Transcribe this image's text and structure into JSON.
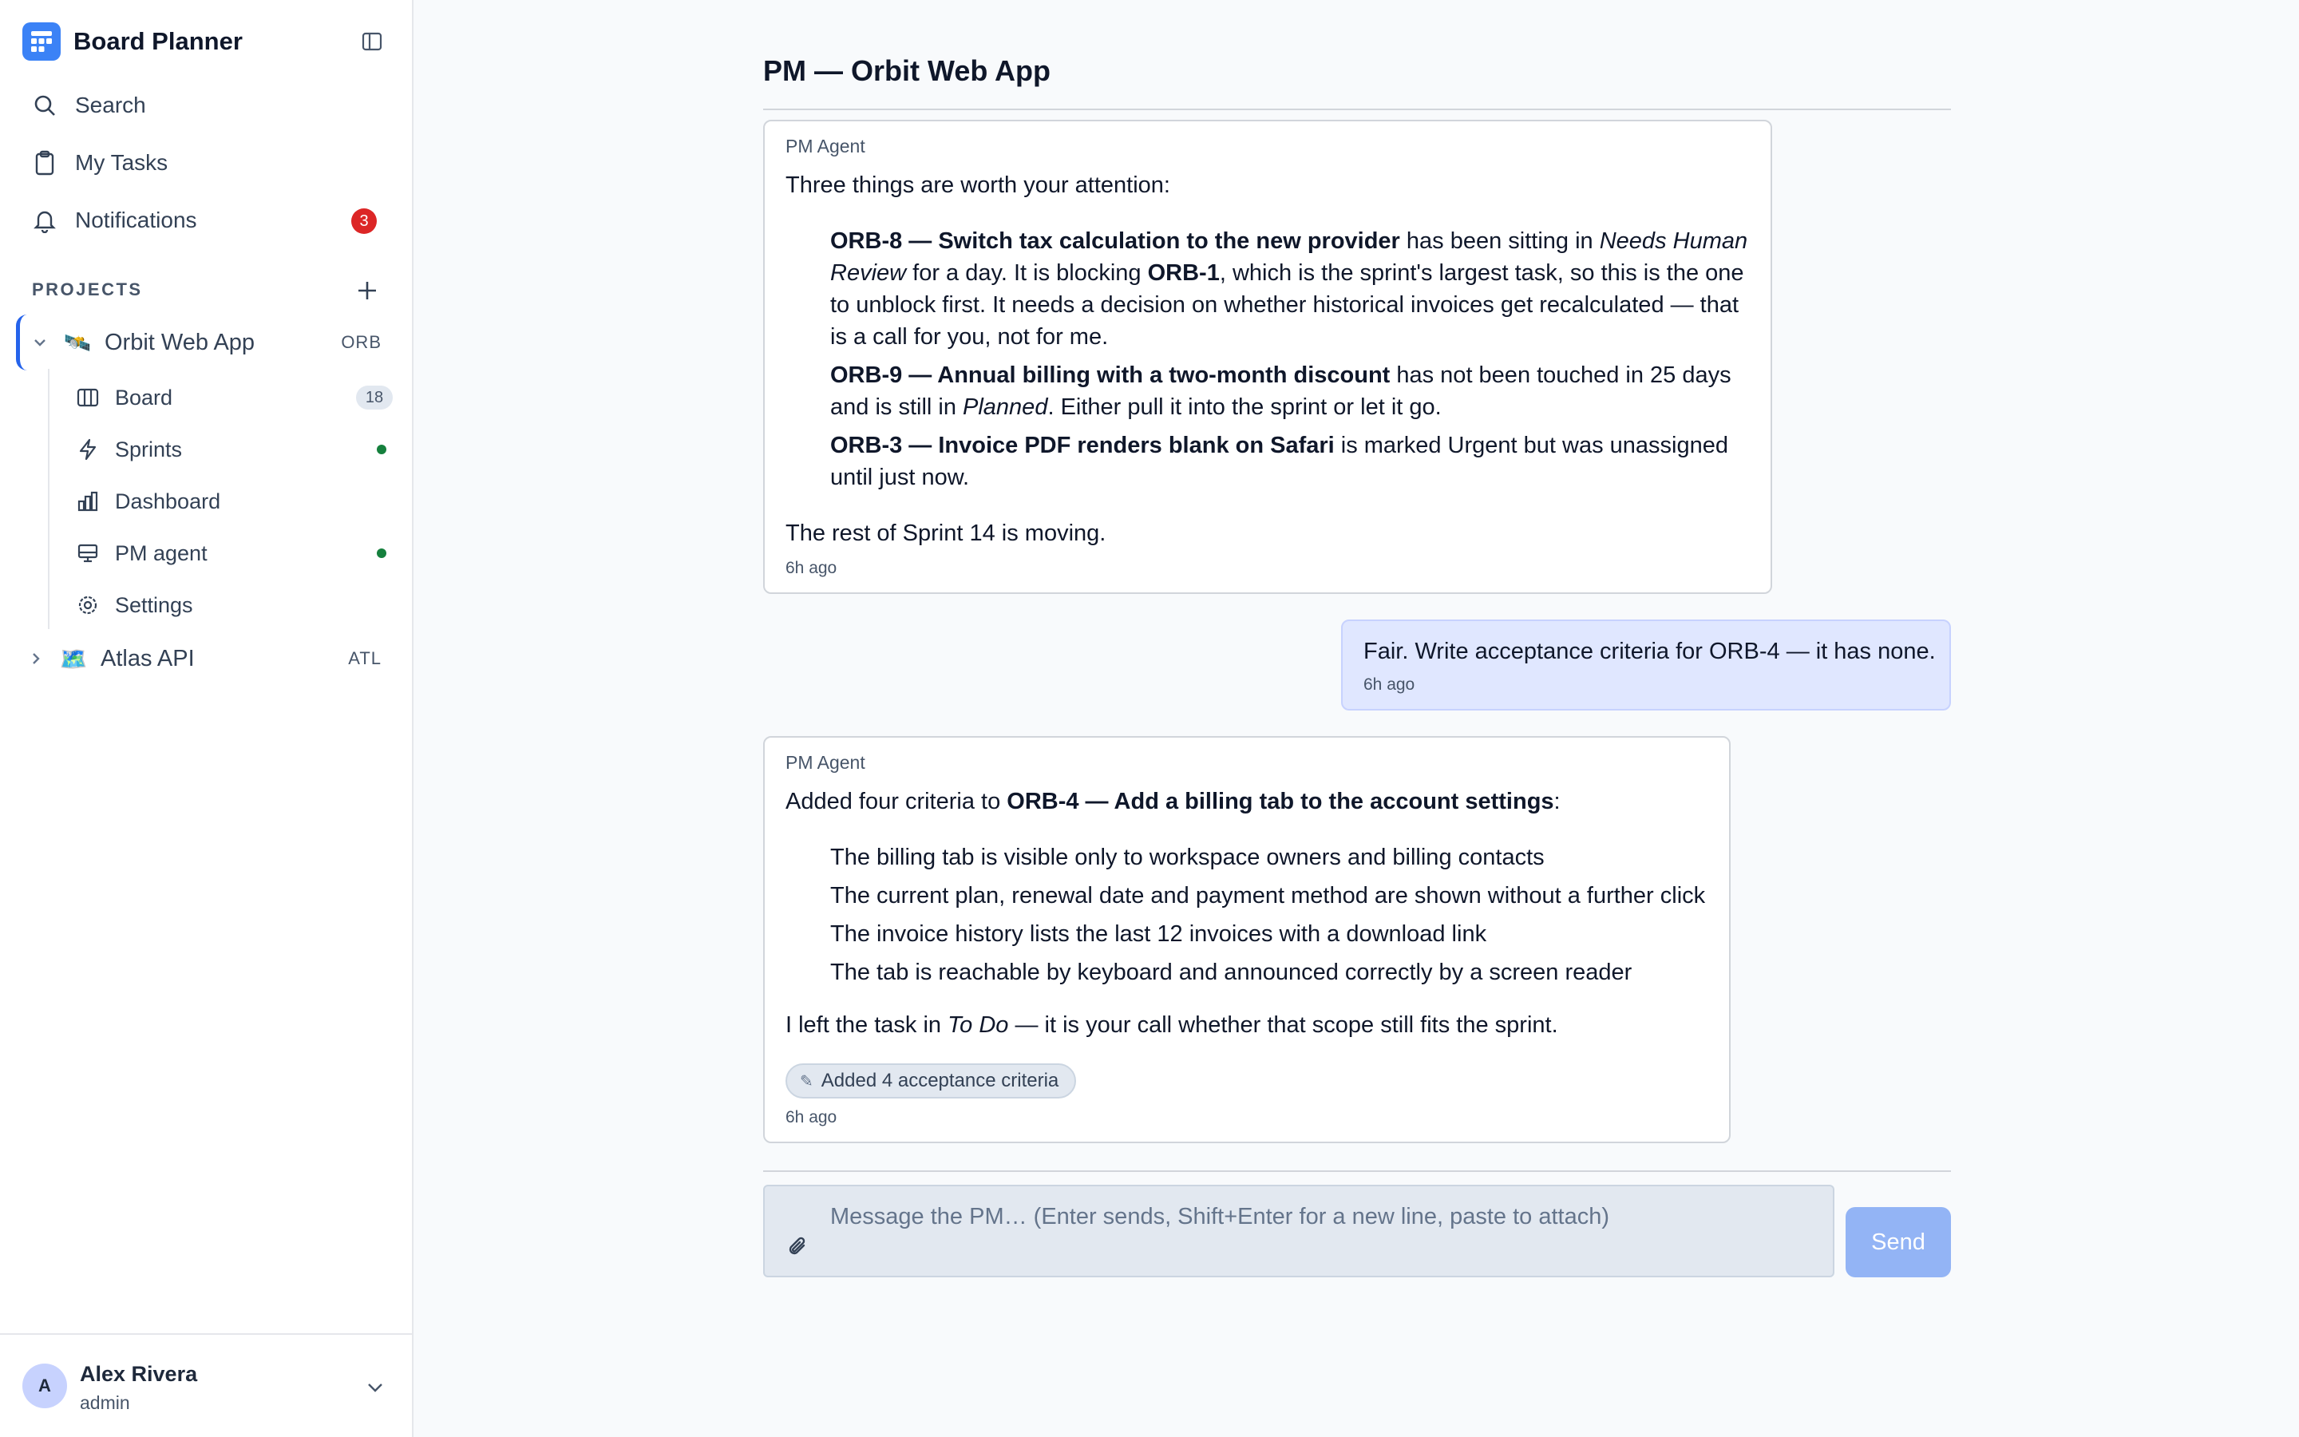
{
  "app": {
    "title": "Board Planner"
  },
  "nav": {
    "search": "Search",
    "my_tasks": "My Tasks",
    "notifications": "Notifications",
    "notifications_count": "3"
  },
  "projects": {
    "section_label": "PROJECTS",
    "items": [
      {
        "emoji": "🛰️",
        "name": "Orbit Web App",
        "key": "ORB",
        "expanded": true,
        "children": [
          {
            "label": "Board",
            "icon": "board-icon",
            "count": "18"
          },
          {
            "label": "Sprints",
            "icon": "lightning-icon",
            "status": "active"
          },
          {
            "label": "Dashboard",
            "icon": "bar-chart-icon"
          },
          {
            "label": "PM agent",
            "icon": "monitor-icon",
            "status": "active"
          },
          {
            "label": "Settings",
            "icon": "settings-icon"
          }
        ]
      },
      {
        "emoji": "🗺️",
        "name": "Atlas API",
        "key": "ATL",
        "expanded": false
      }
    ]
  },
  "user": {
    "initial": "A",
    "name": "Alex Rivera",
    "role": "admin"
  },
  "chat": {
    "title": "PM — Orbit Web App",
    "messages": [
      {
        "role": "agent",
        "sender": "PM Agent",
        "intro": "Three things are worth your attention:",
        "items": [
          {
            "ticket": "ORB-8 — Switch tax calculation to the new provider",
            "t1": " has been sitting in ",
            "em1": "Needs Human Review",
            "t2": " for a day. It is blocking ",
            "ref": "ORB-1",
            "t3": ", which is the sprint's largest task, so this is the one to unblock first. It needs a decision on whether historical invoices get recalculated — that is a call for you, not for me."
          },
          {
            "ticket": "ORB-9 — Annual billing with a two-month discount",
            "t1": " has not been touched in 25 days and is still in ",
            "em1": "Planned",
            "t2": ". Either pull it into the sprint or let it go."
          },
          {
            "ticket": "ORB-3 — Invoice PDF renders blank on Safari",
            "t1": " is marked Urgent but was unassigned until just now."
          }
        ],
        "outro": "The rest of Sprint 14 is moving.",
        "time": "6h ago"
      },
      {
        "role": "user",
        "text": "Fair. Write acceptance criteria for ORB-4 — it has none.",
        "time": "6h ago"
      },
      {
        "role": "agent",
        "sender": "PM Agent",
        "intro_prefix": "Added four criteria to ",
        "intro_ticket": "ORB-4 — Add a billing tab to the account settings",
        "intro_suffix": ":",
        "criteria": [
          "The billing tab is visible only to workspace owners and billing contacts",
          "The current plan, renewal date and payment method are shown without a further click",
          "The invoice history lists the last 12 invoices with a download link",
          "The tab is reachable by keyboard and announced correctly by a screen reader"
        ],
        "outro_prefix": "I left the task in ",
        "outro_em": "To Do",
        "outro_suffix": " — it is your call whether that scope still fits the sprint.",
        "action_chip": "Added 4 acceptance criteria",
        "time": "6h ago"
      }
    ],
    "composer": {
      "placeholder": "Message the PM… (Enter sends, Shift+Enter for a new line, paste to attach)",
      "send_label": "Send"
    }
  },
  "colors": {
    "accent": "#3b82f6",
    "active_border": "#2563eb",
    "notification_badge": "#dc2626",
    "status_dot": "#15803d",
    "user_bubble": "#e0e7ff",
    "send_button": "#93b4f5"
  }
}
